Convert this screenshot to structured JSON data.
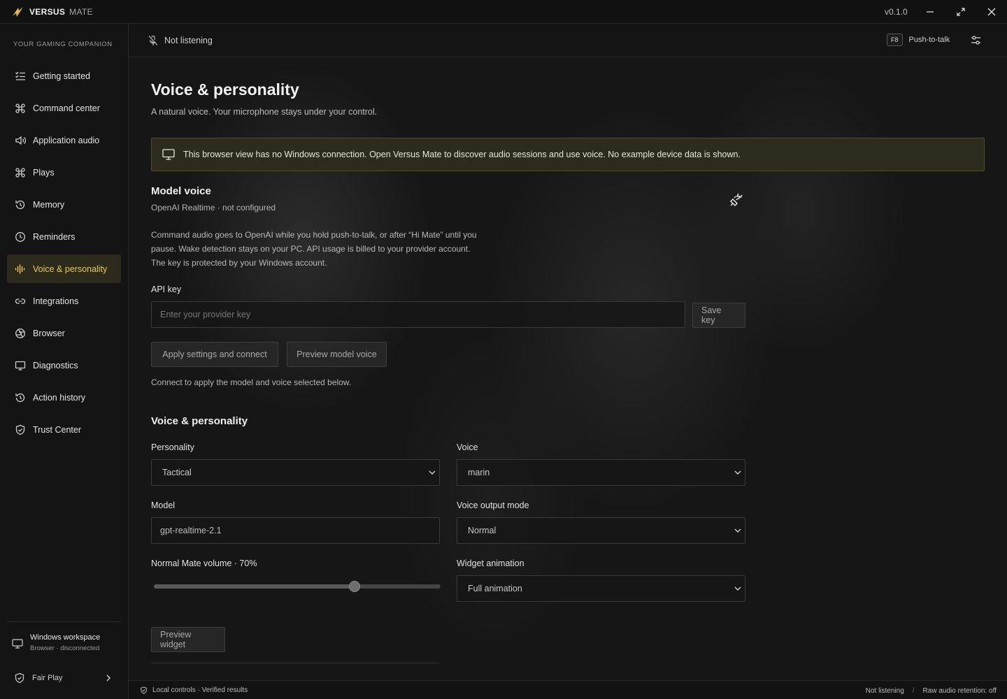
{
  "app": {
    "name_bold": "VERSUS",
    "name_light": "MATE",
    "version": "v0.1.0"
  },
  "sidebar": {
    "tagline": "YOUR GAMING COMPANION",
    "items": [
      {
        "label": "Getting started",
        "icon": "checklist-icon"
      },
      {
        "label": "Command center",
        "icon": "command-icon"
      },
      {
        "label": "Application audio",
        "icon": "speaker-icon"
      },
      {
        "label": "Plays",
        "icon": "command-icon"
      },
      {
        "label": "Memory",
        "icon": "history-icon"
      },
      {
        "label": "Reminders",
        "icon": "clock-icon"
      },
      {
        "label": "Voice & personality",
        "icon": "waveform-icon",
        "active": true
      },
      {
        "label": "Integrations",
        "icon": "link-icon"
      },
      {
        "label": "Browser",
        "icon": "aperture-icon"
      },
      {
        "label": "Diagnostics",
        "icon": "monitor-icon"
      },
      {
        "label": "Action history",
        "icon": "history-icon"
      },
      {
        "label": "Trust Center",
        "icon": "shield-check-icon"
      }
    ],
    "workspace": {
      "title": "Windows workspace",
      "status": "Browser · disconnected"
    },
    "fair_play": "Fair Play"
  },
  "topbar": {
    "listening": "Not listening",
    "key": "F8",
    "ptt": "Push-to-talk"
  },
  "page": {
    "title": "Voice & personality",
    "subtitle": "A natural voice. Your microphone stays under your control.",
    "banner": "This browser view has no Windows connection. Open Versus Mate to discover audio sessions and use voice. No example device data is shown.",
    "model_voice": {
      "title": "Model voice",
      "status": "OpenAI Realtime · not configured",
      "paragraph": "Command audio goes to OpenAI while you hold push-to-talk, or after “Hi Mate” until you pause. Wake detection stays on your PC. API usage is billed to your provider account. The key is protected by your Windows account.",
      "api_key_label": "API key",
      "api_key_placeholder": "Enter your provider key",
      "save_key": "Save key",
      "apply": "Apply settings and connect",
      "preview": "Preview model voice",
      "hint": "Connect to apply the model and voice selected below."
    },
    "voice_personality": {
      "title": "Voice & personality",
      "personality_label": "Personality",
      "personality_value": "Tactical",
      "voice_label": "Voice",
      "voice_value": "marin",
      "model_label": "Model",
      "model_value": "gpt-realtime-2.1",
      "output_label": "Voice output mode",
      "output_value": "Normal",
      "volume_label": "Normal Mate volume · 70%",
      "volume": 0.7,
      "animation_label": "Widget animation",
      "animation_value": "Full animation",
      "preview_widget": "Preview widget"
    }
  },
  "footer": {
    "left": "Local controls · Verified results",
    "right_status": "Not listening",
    "separator": "/",
    "retention": "Raw audio retention: off"
  },
  "colors": {
    "accent": "#e9c85a",
    "banner_bg": "#2c2b1e",
    "active_bg": "#2c2a1d"
  }
}
